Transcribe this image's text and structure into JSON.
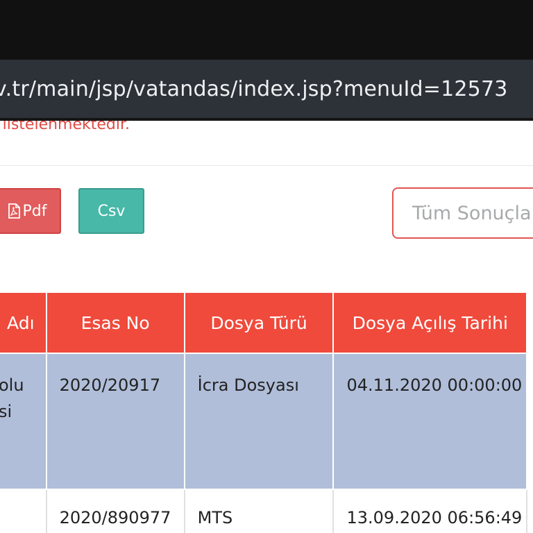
{
  "browser": {
    "url": "v.tr/main/jsp/vatandas/index.jsp?menuId=12573"
  },
  "notice": {
    "text": "t listelenmektedir."
  },
  "toolbar": {
    "pdf_label": "Pdf",
    "csv_label": "Csv",
    "search_placeholder": "Tüm Sonuçla"
  },
  "table": {
    "headers": [
      "Adı",
      "Esas No",
      "Dosya Türü",
      "Dosya Açılış Tarihi"
    ],
    "rows": [
      {
        "col0_line1": "olu",
        "col0_line2": "si",
        "esas_no": "2020/20917",
        "dosya_turu": "İcra Dosyası",
        "acilis_tarihi": "04.11.2020 00:00:00"
      },
      {
        "col0_line1": "",
        "col0_line2": "",
        "esas_no": "2020/890977",
        "dosya_turu": "MTS",
        "acilis_tarihi": "13.09.2020 06:56:49"
      }
    ]
  },
  "colors": {
    "header_red": "#ef4a3c",
    "row_blue": "#b0bed9",
    "pdf_button": "#e15c5c",
    "csv_button": "#48b8a8"
  },
  "icons": {
    "pdf": "pdf-file-icon"
  }
}
